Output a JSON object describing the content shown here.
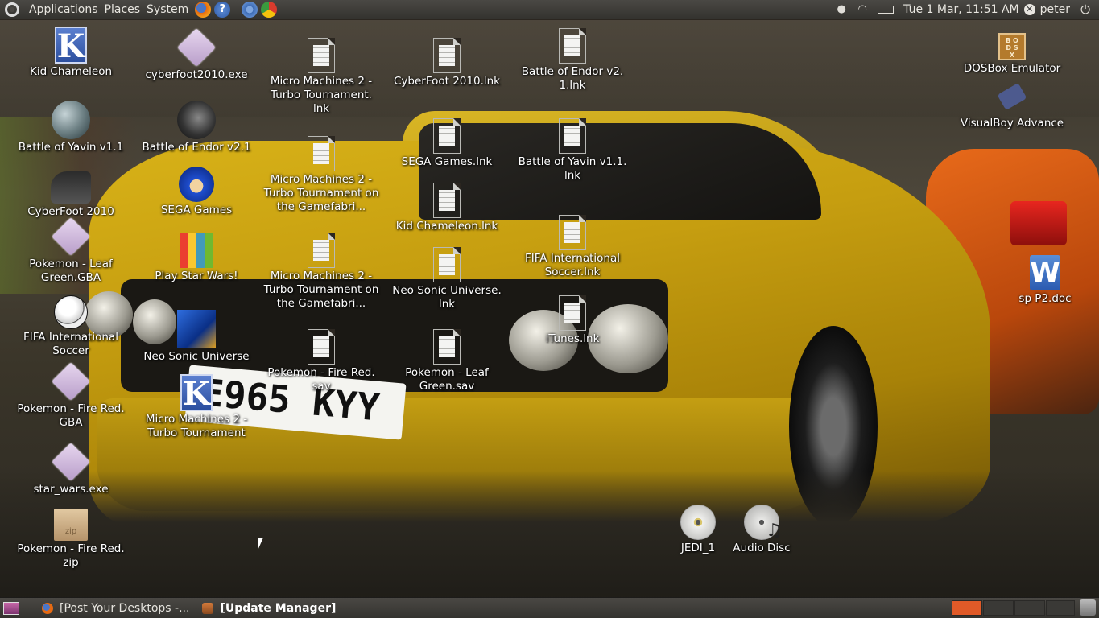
{
  "top_panel": {
    "menus": [
      "Applications",
      "Places",
      "System"
    ],
    "clock": "Tue  1 Mar, 11:51 AM",
    "user": "peter"
  },
  "desktop_icons": [
    {
      "label": "Kid Chameleon",
      "icon": "kde-icon"
    },
    {
      "label": "cyberfoot2010.exe",
      "icon": "executable-icon"
    },
    {
      "label": "Micro Machines 2 - Turbo Tournament. lnk",
      "icon": "document-icon"
    },
    {
      "label": "CyberFoot 2010.lnk",
      "icon": "document-icon"
    },
    {
      "label": "Battle of Endor v2. 1.lnk",
      "icon": "document-icon"
    },
    {
      "label": "DOSBox Emulator",
      "icon": "dosbox-icon"
    },
    {
      "label": "Battle of Yavin v1.1",
      "icon": "death-star-icon"
    },
    {
      "label": "Battle of Endor v2.1",
      "icon": "death-star-icon"
    },
    {
      "label": "Micro Machines 2 - Turbo Tournament on the Gamefabri...",
      "icon": "document-icon"
    },
    {
      "label": "SEGA Games.lnk",
      "icon": "document-icon"
    },
    {
      "label": "Battle of Yavin v1.1. lnk",
      "icon": "document-icon"
    },
    {
      "label": "VisualBoy Advance",
      "icon": "gameboy-icon"
    },
    {
      "label": "CyberFoot 2010",
      "icon": "football-boot-icon"
    },
    {
      "label": "SEGA Games",
      "icon": "sonic-icon"
    },
    {
      "label": "Kid Chameleon.lnk",
      "icon": "document-icon"
    },
    {
      "label": "Pokemon - Leaf Green.GBA",
      "icon": "executable-icon"
    },
    {
      "label": "Play Star Wars!",
      "icon": "sprite-icon"
    },
    {
      "label": "Micro Machines 2 - Turbo Tournament on the Gamefabri...",
      "icon": "document-icon"
    },
    {
      "label": "Neo Sonic Universe. lnk",
      "icon": "document-icon"
    },
    {
      "label": "FIFA International Soccer.lnk",
      "icon": "document-icon"
    },
    {
      "label": "sp P2.doc",
      "icon": "word-document-icon"
    },
    {
      "label": "FIFA International Soccer",
      "icon": "soccer-ball-icon"
    },
    {
      "label": "Neo Sonic Universe",
      "icon": "sonic-art-icon"
    },
    {
      "label": "iTunes.lnk",
      "icon": "document-icon"
    },
    {
      "label": "Pokemon - Fire Red. sav",
      "icon": "document-icon"
    },
    {
      "label": "Pokemon - Leaf Green.sav",
      "icon": "document-icon"
    },
    {
      "label": "Pokemon - Fire Red. GBA",
      "icon": "executable-icon"
    },
    {
      "label": "Micro Machines 2 - Turbo Tournament",
      "icon": "kde-icon"
    },
    {
      "label": "star_wars.exe",
      "icon": "executable-icon"
    },
    {
      "label": "JEDI_1",
      "icon": "cd-icon"
    },
    {
      "label": "Audio Disc",
      "icon": "audio-disc-icon"
    },
    {
      "label": "Pokemon - Fire Red. zip",
      "icon": "zip-archive-icon"
    }
  ],
  "bottom_panel": {
    "tasks": [
      {
        "label": "[Post Your Desktops -...",
        "icon": "firefox-icon",
        "active": false
      },
      {
        "label": "[Update Manager]",
        "icon": "update-manager-icon",
        "active": true
      }
    ],
    "workspace_colors": [
      "#e05a28",
      "#3a3936",
      "#3a3936",
      "#3a3936"
    ]
  },
  "colors": {
    "panel": "#3e3d39",
    "accent": "#e05a28",
    "car": "#d4ae16"
  }
}
